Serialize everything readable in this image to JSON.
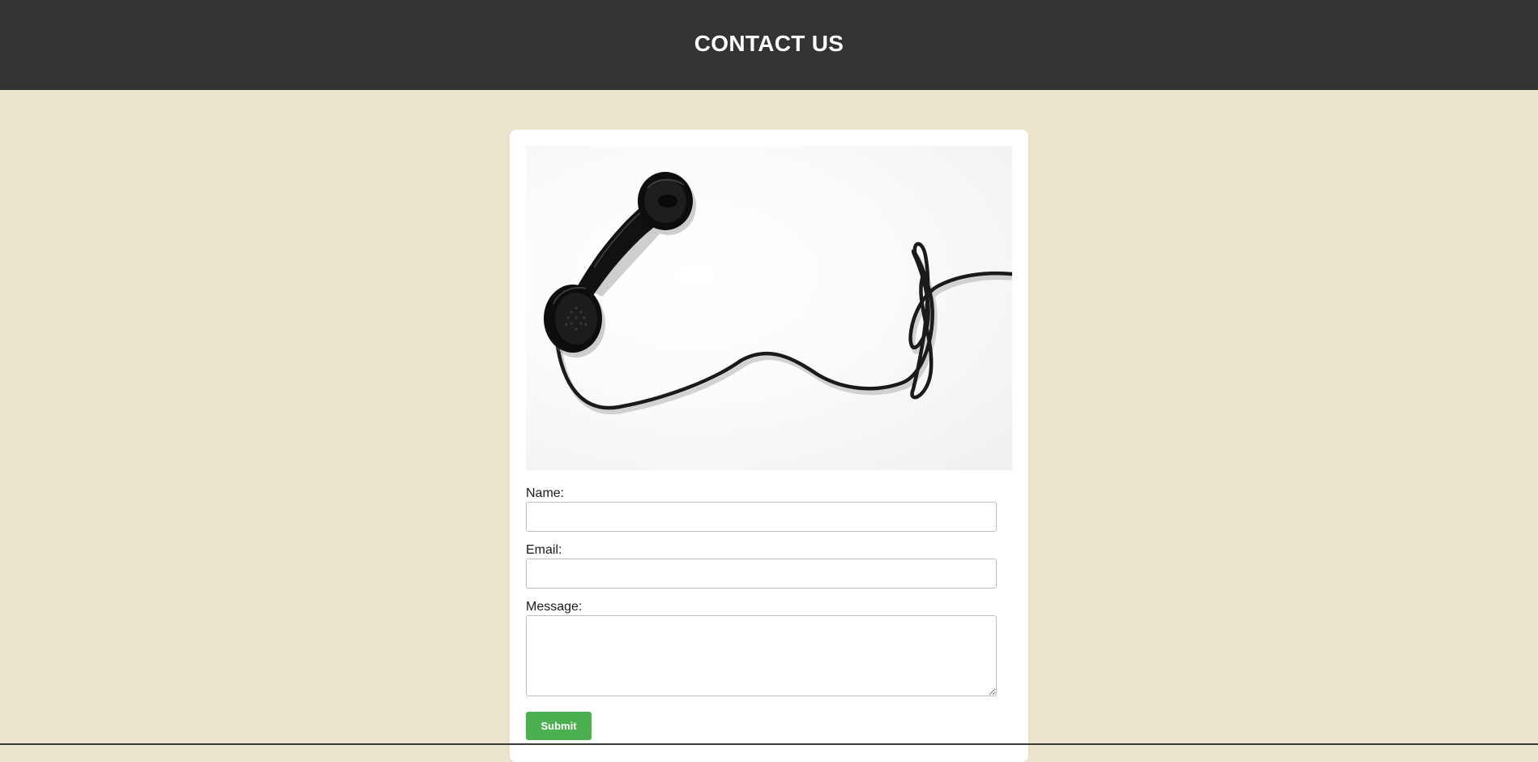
{
  "header": {
    "title": "CONTACT US"
  },
  "colors": {
    "header_bg": "#333333",
    "page_bg": "#ebe5cd",
    "card_bg": "#ffffff",
    "submit_bg": "#4caf50"
  },
  "image": {
    "subject": "black-rotary-telephone-handset-with-cord"
  },
  "form": {
    "name_label": "Name:",
    "name_value": "",
    "email_label": "Email:",
    "email_value": "",
    "message_label": "Message:",
    "message_value": "",
    "submit_label": "Submit"
  }
}
